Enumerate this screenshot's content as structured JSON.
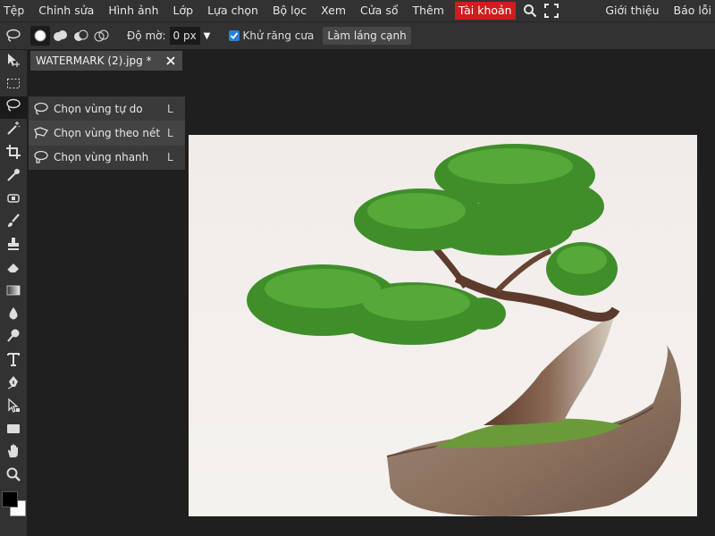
{
  "menubar": {
    "items": [
      "Tệp",
      "Chỉnh sửa",
      "Hình ảnh",
      "Lớp",
      "Lựa chọn",
      "Bộ lọc",
      "Xem",
      "Cửa sổ",
      "Thêm"
    ],
    "account": "Tài khoản",
    "right": [
      "Giới thiệu",
      "Báo lỗi"
    ],
    "account_color": "#d11c1c"
  },
  "options": {
    "feather_label": "Độ mờ:",
    "feather_value": "0 px",
    "antialias_label": "Khử răng cưa",
    "antialias_checked": true,
    "refine_label": "Làm láng cạnh",
    "modes": [
      "new-selection",
      "add-to-selection",
      "subtract-from-selection",
      "intersect-selection"
    ]
  },
  "document": {
    "tab_title": "WATERMARK (2).jpg *"
  },
  "lasso_flyout": {
    "items": [
      {
        "label": "Chọn vùng tự do",
        "shortcut": "L",
        "icon": "lasso-icon"
      },
      {
        "label": "Chọn vùng theo nét",
        "shortcut": "L",
        "icon": "polygonal-lasso-icon"
      },
      {
        "label": "Chọn vùng nhanh",
        "shortcut": "L",
        "icon": "magnetic-lasso-icon"
      }
    ]
  },
  "tools": [
    "move-icon",
    "marquee-icon",
    "lasso-icon",
    "magic-wand-icon",
    "crop-icon",
    "eyedropper-icon",
    "healing-icon",
    "brush-icon",
    "stamp-icon",
    "eraser-icon",
    "gradient-icon",
    "blur-icon",
    "dodge-icon",
    "text-icon",
    "pen-icon",
    "path-select-icon",
    "shape-icon",
    "hand-icon",
    "zoom-icon"
  ],
  "colors": {
    "foreground": "#000000",
    "background": "#ffffff",
    "ui_panel": "#323232",
    "workspace": "#1f1f1f",
    "checkbox": "#2a7ee0"
  },
  "canvas_image": "bonsai-tree-in-rock-pot"
}
